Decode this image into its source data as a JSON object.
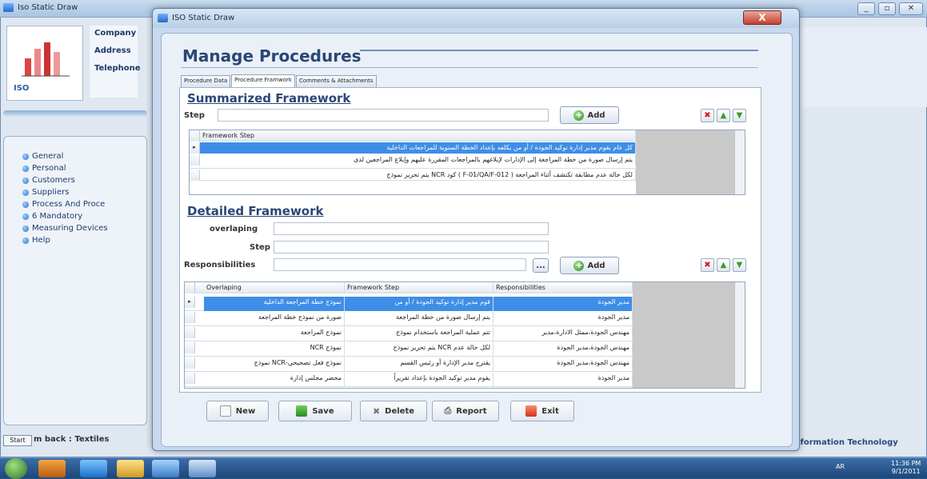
{
  "background_window": {
    "title": "Iso Static Draw",
    "company_labels": [
      "Company",
      "Address",
      "Telephone"
    ],
    "logo_text": "ISO",
    "nav_items": [
      "General",
      "Personal",
      "Customers",
      "Suppliers",
      "Process And Proce",
      "6 Mandatory",
      "Measuring Devices",
      "Help"
    ],
    "start_button": "Start",
    "status_text": "m back : Textiles",
    "status_right": "/Information Technology"
  },
  "taskbar": {
    "lang": "AR",
    "time": "11:36 PM",
    "date": "9/1/2011"
  },
  "dialog": {
    "title": "ISO Static Draw",
    "close_label": "X",
    "heading": "Manage Procedures",
    "tabs": [
      "Procedure Data",
      "Procedure Framwork",
      "Comments & Attachments"
    ],
    "summarized": {
      "title": "Summarized Framework",
      "step_label": "Step",
      "step_value": "",
      "add_label": "Add",
      "column": "Framework Step",
      "rows": [
        "كل عام يقوم مدير إدارة توكيد الجودة / أو من يكلفه بإعداد الخطة السنوية للمراجعات الداخلية",
        "يتم إرسال صورة من خطة المراجعة إلى الإدارات لإبلاغهم بالمراجعات المقررة عليهم وإبلاغ المراجعين لدى",
        "لكل حالة عدم مطابقة تكتشف أثناء المراجعة ( F-01/QA/F-012 ) كود NCR يتم تحرير نموذج"
      ]
    },
    "detailed": {
      "title": "Detailed Framework",
      "overlaping_label": "overlaping",
      "step_label": "Step",
      "resp_label": "Responsibilities",
      "browse_label": "...",
      "add_label": "Add",
      "columns": [
        "Overlaping",
        "Framework Step",
        "Responsibilities"
      ],
      "rows": [
        [
          "نموذج خطة المراجعة الداخلية",
          "قوم مدير إدارة توكيد الجودة / أو من",
          "مدير الجودة"
        ],
        [
          "صورة من نموذج خطة المراجعة",
          "يتم إرسال صورة من خطة المراجعة",
          "مدير الجودة"
        ],
        [
          "نموذج المراجعة",
          "تتم عملية المراجعة باستخدام نموذج",
          "مهندس الجودة،ممثل الادارة،مدير"
        ],
        [
          "نموذج NCR",
          "لكل حالة عدم NCR يتم تحرير نموذج",
          "مهندس الجودة،مدير الجودة"
        ],
        [
          "نموذج فعل تصحيحي-NCR نموذج",
          "يقترح مدير الإدارة أو رئيس القسم",
          "مهندس الجودة،مدير الجودة"
        ],
        [
          "محضر مجلس إدارة",
          "يقوم مدير توكيد الجودة بإعداد تقريراً",
          "مدير الجودة"
        ]
      ]
    },
    "buttons": [
      "New",
      "Save",
      "Delete",
      "Report",
      "Exit"
    ]
  }
}
